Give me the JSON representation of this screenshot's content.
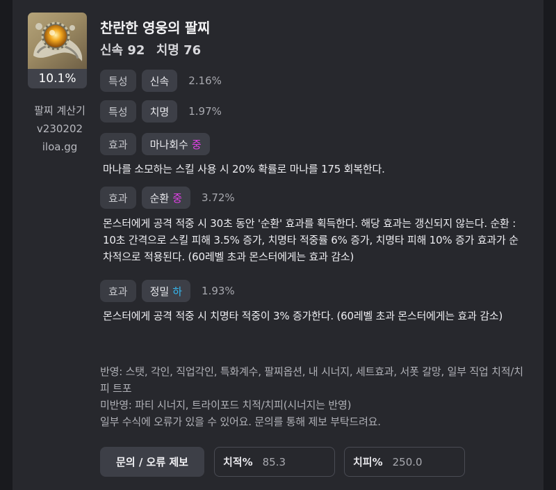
{
  "item": {
    "icon": "bracelet-icon",
    "percent": "10.1%",
    "name": "찬란한 영웅의 팔찌",
    "stats": [
      "신속 92",
      "치명 76"
    ]
  },
  "calculator": {
    "line1": "팔찌 계산기",
    "line2": "v230202",
    "line3": "iloa.gg"
  },
  "options": [
    {
      "tag": "특성",
      "name": "신속",
      "grade": "",
      "value": "2.16%",
      "desc": ""
    },
    {
      "tag": "특성",
      "name": "치명",
      "grade": "",
      "value": "1.97%",
      "desc": ""
    },
    {
      "tag": "효과",
      "name": "마나회수",
      "grade": "중",
      "value": "",
      "desc": "마나를 소모하는 스킬 사용 시 20% 확률로 마나를 175 회복한다."
    },
    {
      "tag": "효과",
      "name": "순환",
      "grade": "중",
      "value": "3.72%",
      "desc": "몬스터에게 공격 적중 시 30초 동안 '순환' 효과를 획득한다. 해당 효과는 갱신되지 않는다. 순환 : 10초 간격으로 스킬 피해 3.5% 증가, 치명타 적중률 6% 증가, 치명타 피해 10% 증가 효과가 순차적으로 적용된다. (60레벨 초과 몬스터에게는 효과 감소)"
    },
    {
      "tag": "효과",
      "name": "정밀",
      "grade": "하",
      "value": "1.93%",
      "desc": "몬스터에게 공격 적중 시 치명타 적중이 3% 증가한다. (60레벨 초과 몬스터에게는 효과 감소)"
    }
  ],
  "notes": {
    "applied": "반영: 스탯, 각인, 직업각인, 특화계수, 팔찌옵션, 내 시너지, 세트효과, 서폿 갈망, 일부 직업 치적/치피 트포",
    "not_applied": "미반영: 파티 시너지, 트라이포드 치적/치피(시너지는 반영)",
    "warning": "일부 수식에 오류가 있을 수 있어요. 문의를 통해 제보 부탁드려요."
  },
  "controls": {
    "report_button": "문의 / 오류 제보",
    "crit_rate_label": "치적%",
    "crit_rate_value": "85.3",
    "crit_dmg_label": "치피%",
    "crit_dmg_value": "250.0"
  },
  "colors": {
    "grade_mid": "#e040e6",
    "grade_low": "#35b8f0"
  }
}
